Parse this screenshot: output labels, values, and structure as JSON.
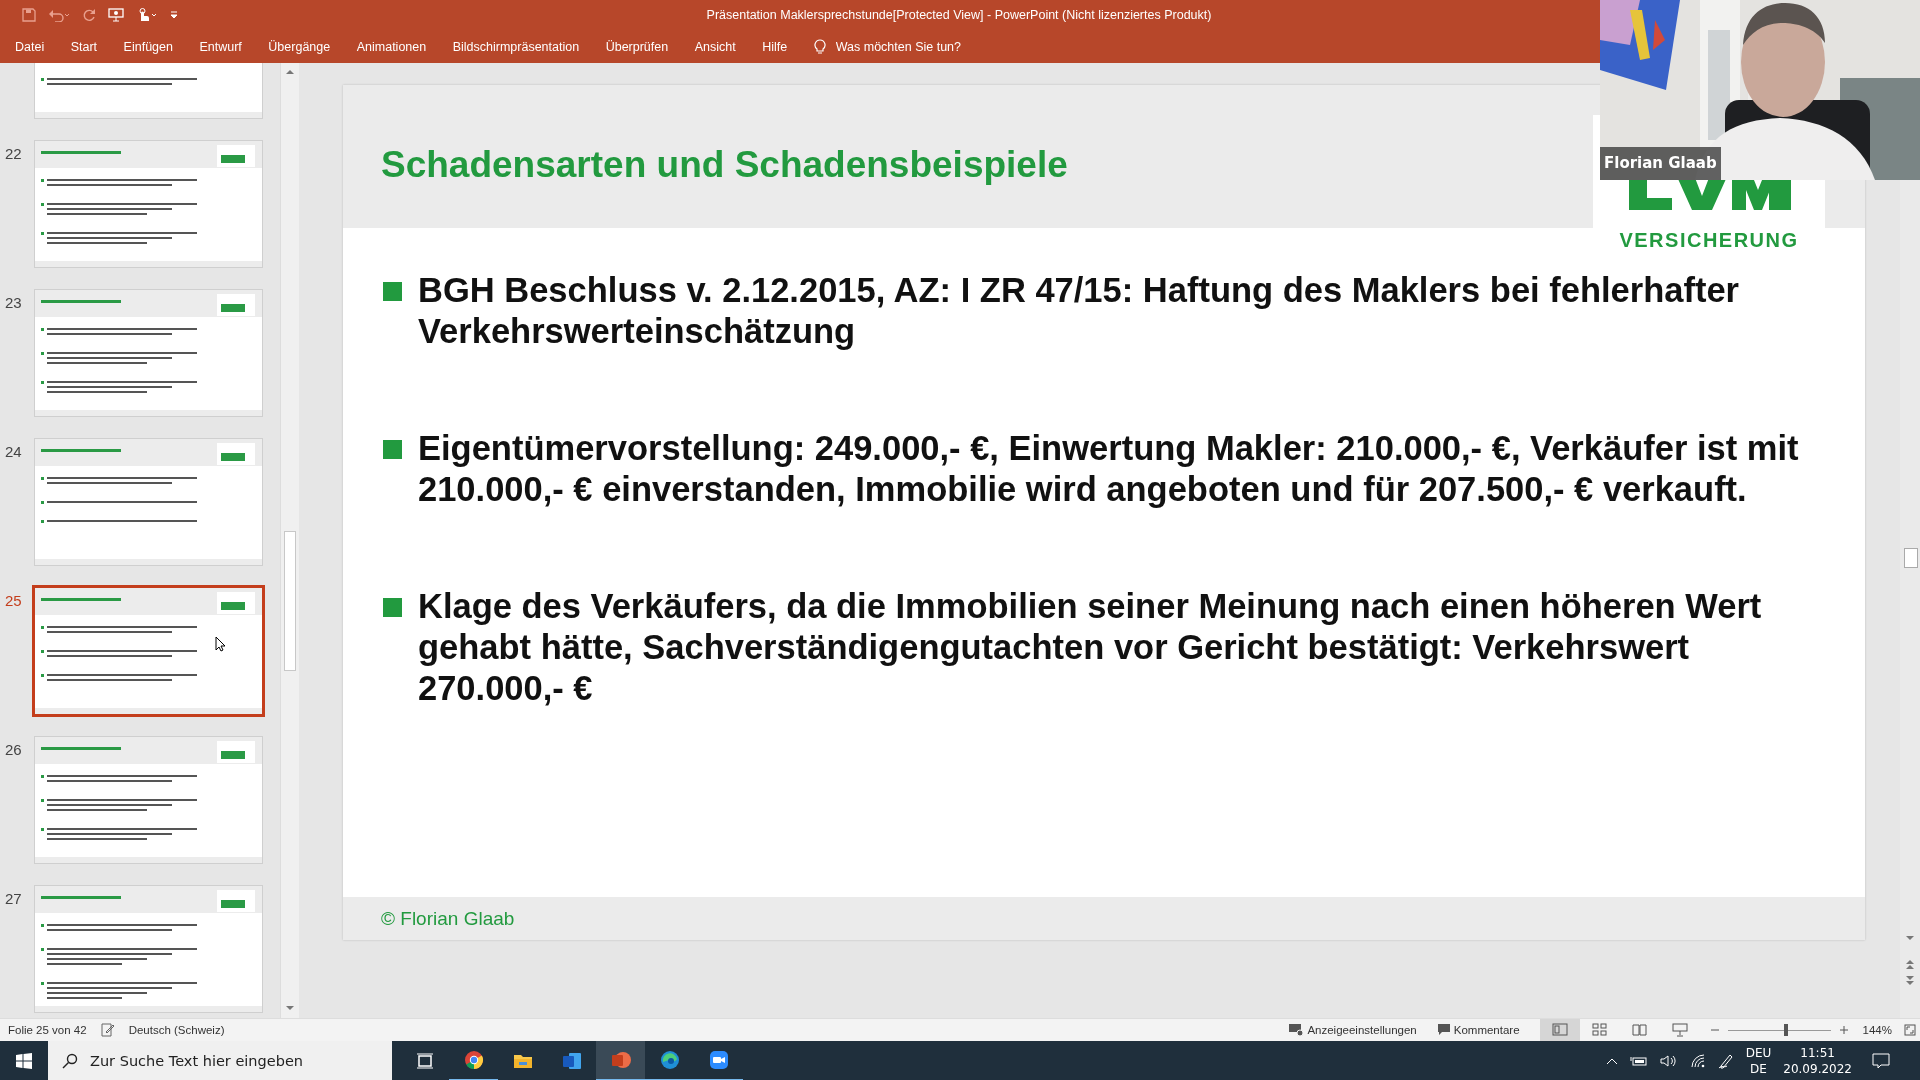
{
  "window": {
    "title": "Präsentation Maklersprechstunde[Protected View]  -  PowerPoint (Nicht lizenziertes Produkt)"
  },
  "menu": [
    {
      "label": "Datei"
    },
    {
      "label": "Start"
    },
    {
      "label": "Einfügen"
    },
    {
      "label": "Entwurf"
    },
    {
      "label": "Übergänge"
    },
    {
      "label": "Animationen"
    },
    {
      "label": "Bildschirmpräsentation"
    },
    {
      "label": "Überprüfen"
    },
    {
      "label": "Ansicht"
    },
    {
      "label": "Hilfe"
    }
  ],
  "tell_me": {
    "placeholder": "Was möchten Sie tun?"
  },
  "thumbnails": [
    {
      "selected": false
    },
    {
      "number": "22",
      "selected": false
    },
    {
      "number": "23",
      "selected": false
    },
    {
      "number": "24",
      "selected": false
    },
    {
      "number": "25",
      "selected": true
    },
    {
      "number": "26",
      "selected": false
    },
    {
      "number": "27",
      "selected": false
    }
  ],
  "slide": {
    "title": "Schadensarten und Schadensbeispiele",
    "logo_text": "VERSICHERUNG",
    "bullets": [
      "BGH Beschluss v. 2.12.2015, AZ: I ZR 47/15: Haftung des Maklers bei fehlerhafter Verkehrswerteinschätzung",
      "Eigentümervorstellung: 249.000,- €, Einwertung Makler: 210.000,- €, Verkäufer ist mit 210.000,- € einverstanden, Immobilie wird angeboten und für 207.500,- € verkauft.",
      "Klage des Verkäufers, da die Immobilien seiner Meinung nach einen höheren Wert gehabt hätte, Sachverständigengutachten vor Gericht bestätigt: Verkehrswert 270.000,- €"
    ],
    "footer": "© Florian Glaab"
  },
  "video": {
    "kind": "picture",
    "name": "Florian Glaab"
  },
  "status_bar": {
    "slide_counter": "Folie 25 von 42",
    "language": "Deutsch (Schweiz)",
    "display_settings": "Anzeigeeinstellungen",
    "comments": "Kommentare",
    "views": [
      {
        "kind": "normal",
        "selected": true
      },
      {
        "kind": "sorter",
        "selected": false
      },
      {
        "kind": "reading",
        "selected": false
      },
      {
        "kind": "show",
        "selected": false
      }
    ],
    "zoom": {
      "level": 0.57,
      "reading": "144%"
    }
  },
  "taskbar": {
    "search": {
      "placeholder": "Zur Suche Text hier eingeben"
    },
    "apps": [
      {
        "kind": "taskview",
        "running": false,
        "selected": false
      },
      {
        "kind": "chrome",
        "running": true,
        "selected": false
      },
      {
        "kind": "explorer",
        "running": false,
        "selected": false
      },
      {
        "kind": "word",
        "running": false,
        "selected": false
      },
      {
        "kind": "powerpoint",
        "running": true,
        "selected": true
      },
      {
        "kind": "edge",
        "running": true,
        "selected": false
      },
      {
        "kind": "zoom",
        "running": true,
        "selected": false
      }
    ],
    "tray": {
      "language": "DEU",
      "keyboard": "DE",
      "time": "11:51",
      "date": "20.09.2022"
    }
  }
}
